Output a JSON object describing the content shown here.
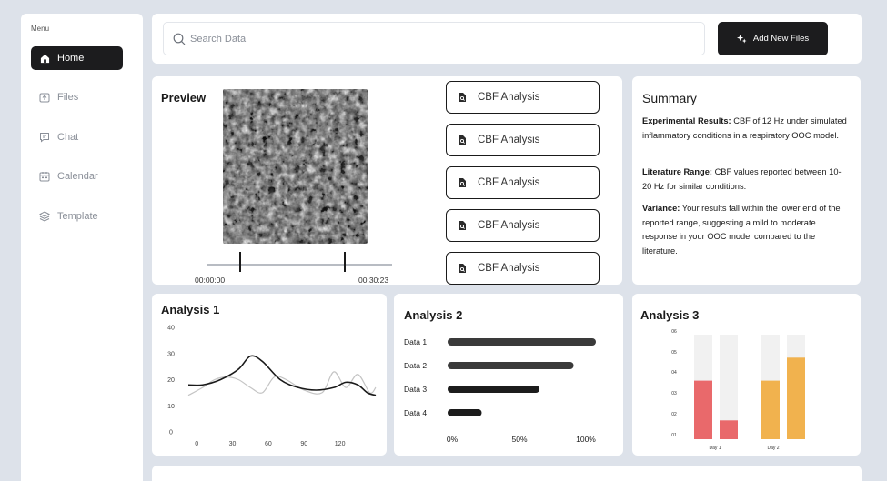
{
  "sidebar": {
    "menu_label": "Menu",
    "items": [
      {
        "label": "Home",
        "icon": "home-icon",
        "active": true
      },
      {
        "label": "Files",
        "icon": "files-icon",
        "active": false
      },
      {
        "label": "Chat",
        "icon": "chat-icon",
        "active": false
      },
      {
        "label": "Calendar",
        "icon": "calendar-icon",
        "active": false
      },
      {
        "label": "Template",
        "icon": "template-icon",
        "active": false
      }
    ]
  },
  "search": {
    "placeholder": "Search Data",
    "value": ""
  },
  "toolbar": {
    "add_files_label": "Add New Files"
  },
  "preview": {
    "title": "Preview",
    "start_time": "00:00:00",
    "end_time": "00:30:23",
    "files": [
      {
        "label": "CBF Analysis"
      },
      {
        "label": "CBF Analysis"
      },
      {
        "label": "CBF Analysis"
      },
      {
        "label": "CBF Analysis"
      },
      {
        "label": "CBF Analysis"
      }
    ]
  },
  "summary": {
    "title": "Summary",
    "paragraphs": [
      {
        "heading": "Experimental Results:",
        "text": " CBF of 12 Hz under simulated inflammatory conditions in a respiratory OOC model."
      },
      {
        "heading": "Literature Range:",
        "text": " CBF values reported between 10-20 Hz for similar conditions."
      },
      {
        "heading": "Variance:",
        "text": " Your results fall within the lower end of the reported range, suggesting a mild to moderate response in your OOC model compared to the literature."
      }
    ]
  },
  "chart_data": [
    {
      "type": "line",
      "title": "Analysis 1",
      "x_ticks": [
        0,
        30,
        60,
        90,
        120
      ],
      "y_ticks": [
        0,
        10,
        20,
        30,
        40
      ],
      "ylim": [
        0,
        40
      ],
      "xlim": [
        -7,
        150
      ],
      "series": [
        {
          "color": "#1a1a1a",
          "x": [
            -7,
            5,
            20,
            35,
            45,
            55,
            70,
            85,
            100,
            115,
            125,
            135,
            143,
            150
          ],
          "y": [
            18,
            18,
            20,
            24,
            29,
            27,
            20,
            17,
            16,
            17,
            19,
            18,
            15,
            14
          ]
        },
        {
          "color": "#c4c4c4",
          "x": [
            -7,
            5,
            15,
            25,
            35,
            45,
            55,
            65,
            75,
            90,
            105,
            115,
            125,
            135,
            145,
            150
          ],
          "y": [
            14,
            17,
            20,
            21,
            20,
            17,
            15,
            21,
            20,
            16,
            15,
            23,
            17,
            22,
            15,
            17
          ]
        }
      ]
    },
    {
      "type": "bar",
      "orientation": "horizontal",
      "title": "Analysis 2",
      "categories": [
        "Data 1",
        "Data 2",
        "Data 3",
        "Data 4"
      ],
      "values": [
        100,
        85,
        62,
        23
      ],
      "colors": [
        "#3a3a3a",
        "#3a3a3a",
        "#1c1c1c",
        "#1c1c1c"
      ],
      "x_ticks": [
        "0%",
        "50%",
        "100%"
      ],
      "xlim": [
        0,
        100
      ]
    },
    {
      "type": "bar",
      "title": "Analysis 3",
      "categories": [
        "Day 1",
        "Day 2"
      ],
      "y_ticks": [
        "01",
        "02",
        "03",
        "04",
        "05",
        "06"
      ],
      "ylim": [
        0.1,
        0.6
      ],
      "bars": [
        {
          "group": "Day 1",
          "value": 0.38,
          "color": "#e9696b"
        },
        {
          "group": "Day 1",
          "value": 0.19,
          "color": "#e9696b"
        },
        {
          "group": "Day 2",
          "value": 0.38,
          "color": "#f1b24e"
        },
        {
          "group": "Day 2",
          "value": 0.49,
          "color": "#f1b24e"
        }
      ],
      "background_color": "#f1f1f1"
    }
  ]
}
